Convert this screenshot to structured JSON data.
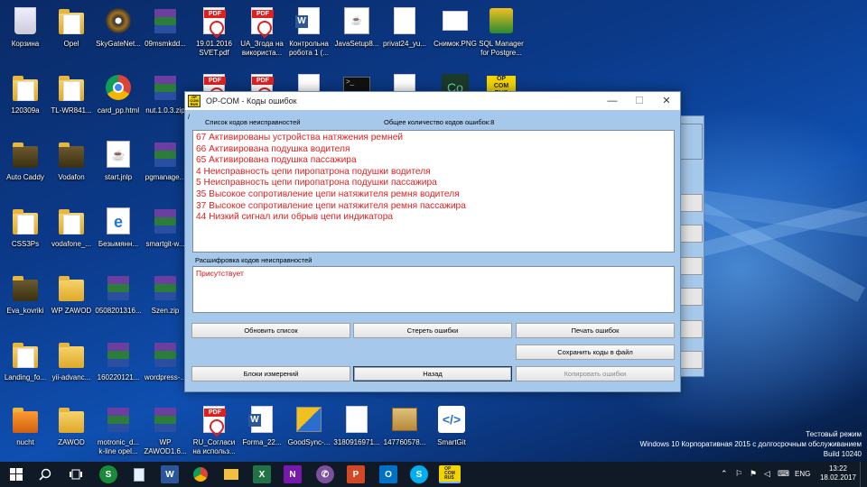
{
  "desktop": {
    "icons": [
      {
        "label": "Корзина"
      },
      {
        "label": "Opel"
      },
      {
        "label": "SkyGateNet..."
      },
      {
        "label": "09msmkdd..."
      },
      {
        "label": "19.01.2016\nSVET.pdf"
      },
      {
        "label": "UA_Згода на\nвикориста..."
      },
      {
        "label": "Контрольна\nробота 1 (..."
      },
      {
        "label": "JavaSetup8..."
      },
      {
        "label": "privat24_yu..."
      },
      {
        "label": "Снимок.PNG"
      },
      {
        "label": "SQL Manager\nfor Postgre..."
      },
      {
        "label": "120309a"
      },
      {
        "label": "TL-WR841..."
      },
      {
        "label": "card_pp.html"
      },
      {
        "label": "nut.1.0.3.zip"
      },
      {
        "label": "Auto Caddy"
      },
      {
        "label": "Vodafon"
      },
      {
        "label": "start.jnlp"
      },
      {
        "label": "pgmanage..."
      },
      {
        "label": "CSS3Ps"
      },
      {
        "label": "vodafone_..."
      },
      {
        "label": "Безымянн..."
      },
      {
        "label": "smartgit-w..."
      },
      {
        "label": "Eva_kovriki"
      },
      {
        "label": "WP ZAWOD"
      },
      {
        "label": "0508201316..."
      },
      {
        "label": "Szen.zip"
      },
      {
        "label": "Landing_fo..."
      },
      {
        "label": "yii-advanc..."
      },
      {
        "label": "160220121..."
      },
      {
        "label": "wordpress-..."
      },
      {
        "label": "nucht"
      },
      {
        "label": "ZAWOD"
      },
      {
        "label": "motronic_d...\nk-line opel..."
      },
      {
        "label": "WP\nZAWOD1.6..."
      },
      {
        "label": "RU_Согласи\nна использ..."
      },
      {
        "label": "Forma_22..."
      },
      {
        "label": "GoodSync-..."
      },
      {
        "label": "3180916971..."
      },
      {
        "label": "147760578..."
      },
      {
        "label": "SmartGit"
      }
    ],
    "opcom_desktop_logo": "OP\nCOM\nRUS"
  },
  "window": {
    "title": "OP-COM - Коды ошибок",
    "min": "—",
    "max": "☐",
    "close": "✕",
    "marker": "/",
    "list_header": "Список кодов неисправностей",
    "count_header": "Общее количество кодов ошибок:8",
    "error_codes": [
      "67  Активированы устройства натяжения ремней",
      "66  Активирована подушка водителя",
      "65  Активирована подушка пассажира",
      "4  Неисправность цепи пиропатрона подушки водителя",
      "5  Неисправность цепи пиропатрона подушки пассажира",
      "35  Высокое сопротивление цепи натяжителя ремня водителя",
      "37  Высокое сопротивление цепи натяжителя ремня пассажира",
      "44  Низкий сигнал или обрыв цепи индикатора"
    ],
    "description_header": "Расшифровка кодов неисправностей",
    "description_text": "Присутствует",
    "buttons": {
      "refresh": "Обновить список",
      "clear": "Стереть ошибки",
      "print": "Печать ошибок",
      "save": "Сохранить коды в файл",
      "blocks": "Блоки измерений",
      "back": "Назад",
      "copy": "Копировать ошибки"
    }
  },
  "taskbar": {
    "apps": [
      "S",
      "W",
      "X",
      "N",
      "P",
      "O",
      "S"
    ],
    "opcom_label": "OP\nCOM\nRUS",
    "lang": "ENG",
    "time": "13:22",
    "date": "18.02.2017"
  },
  "watermark": {
    "line1": "Тестовый режим",
    "line2": "Windows 10 Корпоративная 2015 с долгосрочным обслуживанием",
    "line3": "Build 10240"
  },
  "colors": {
    "window_bg": "#a6c8ea",
    "error_text": "#e22020",
    "taskbar": "#101a26"
  }
}
